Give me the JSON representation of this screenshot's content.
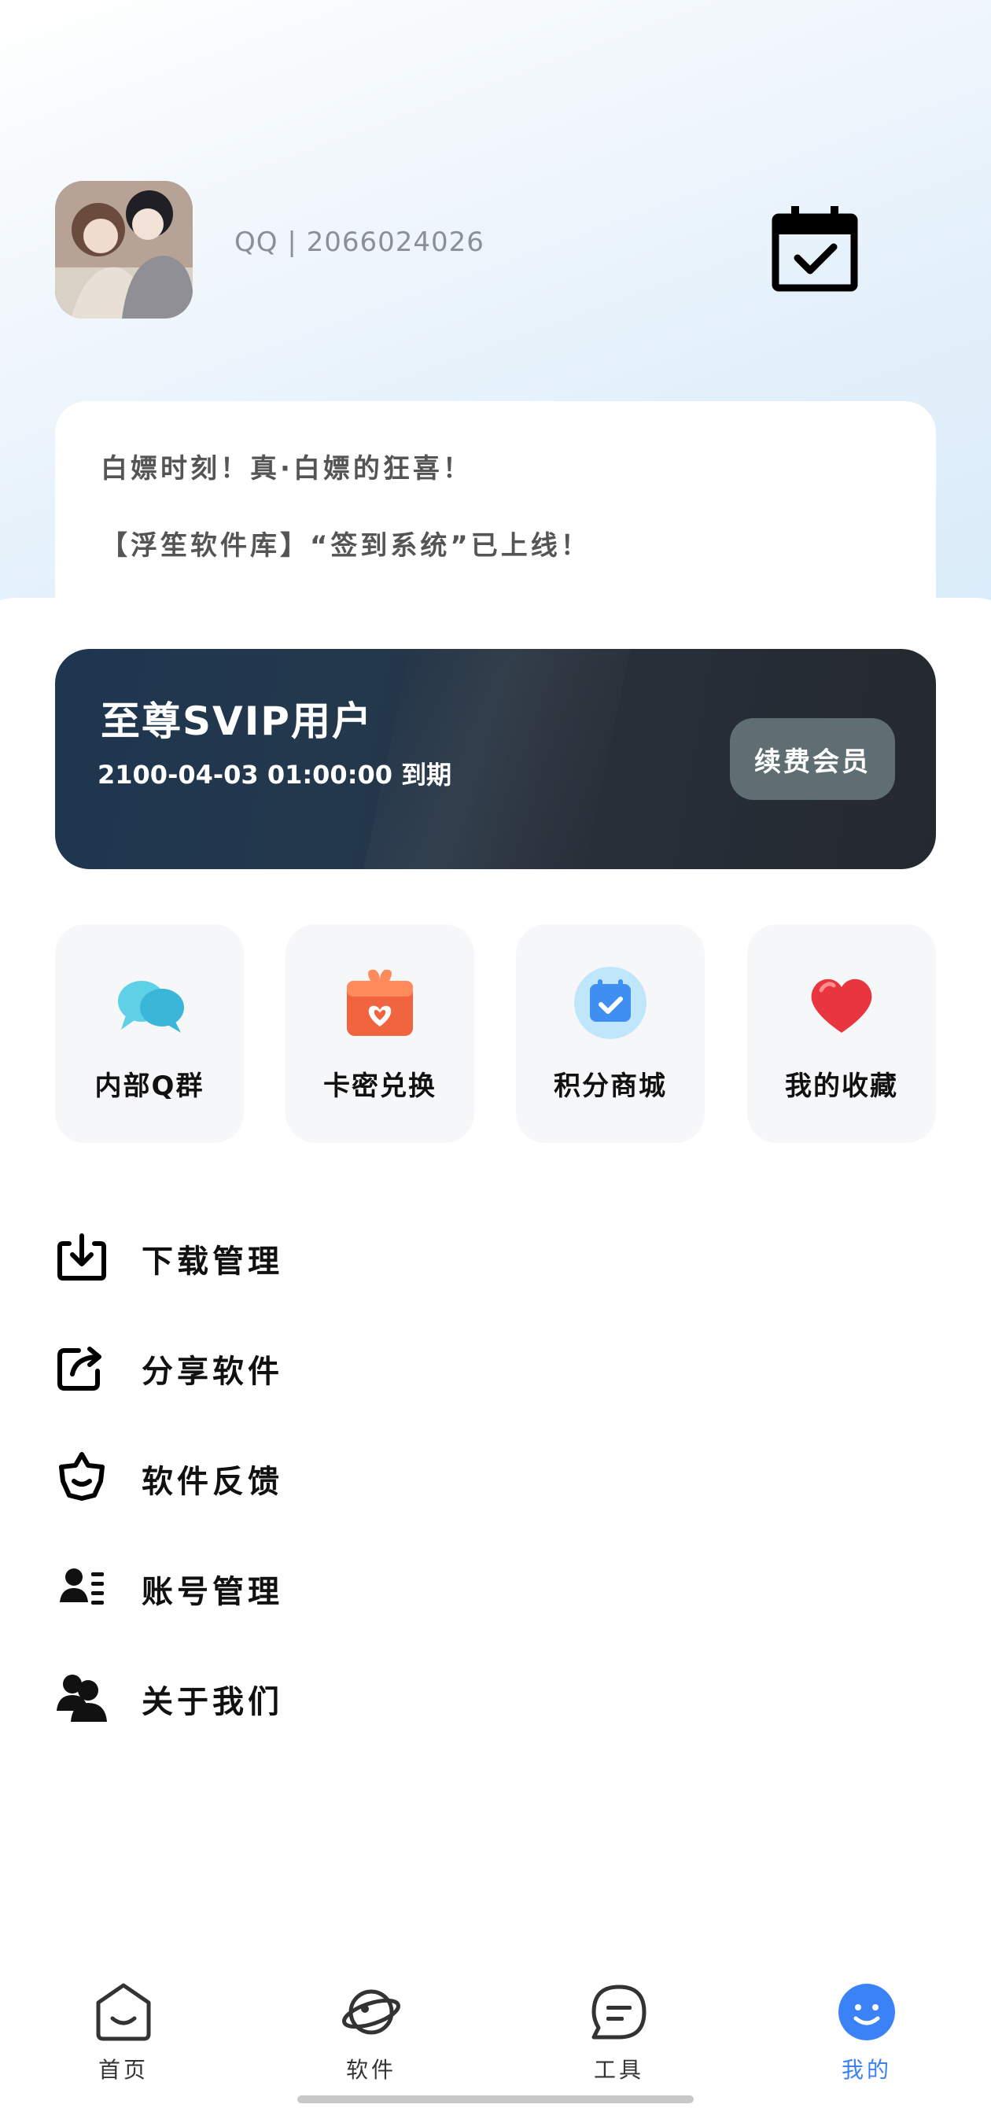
{
  "header": {
    "user_id": "QQ | 2066024026",
    "calendar_icon": "calendar-check-icon"
  },
  "notice": {
    "line1": "白嫖时刻！真·白嫖的狂喜！",
    "line2": "【浮笙软件库】“签到系统”已上线！"
  },
  "vip": {
    "title": "至尊SVIP用户",
    "expire": "2100-04-03 01:00:00 到期",
    "renew_label": "续费会员"
  },
  "quick_actions": [
    {
      "label": "内部Q群",
      "icon": "chat-bubbles-icon"
    },
    {
      "label": "卡密兑换",
      "icon": "gift-box-icon"
    },
    {
      "label": "积分商城",
      "icon": "calendar-check-icon"
    },
    {
      "label": "我的收藏",
      "icon": "heart-icon"
    }
  ],
  "menu": [
    {
      "label": "下载管理",
      "icon": "download-icon"
    },
    {
      "label": "分享软件",
      "icon": "share-icon"
    },
    {
      "label": "软件反馈",
      "icon": "feedback-star-icon"
    },
    {
      "label": "账号管理",
      "icon": "account-card-icon"
    },
    {
      "label": "关于我们",
      "icon": "users-icon"
    }
  ],
  "bottom_nav": [
    {
      "label": "首页",
      "icon": "home-face-icon"
    },
    {
      "label": "软件",
      "icon": "planet-icon"
    },
    {
      "label": "工具",
      "icon": "message-icon"
    },
    {
      "label": "我的",
      "icon": "smile-icon",
      "active": true
    }
  ],
  "colors": {
    "accent": "#3b82f6",
    "vip_bg": "#24384c",
    "renew_bg": "#5f6e73"
  }
}
